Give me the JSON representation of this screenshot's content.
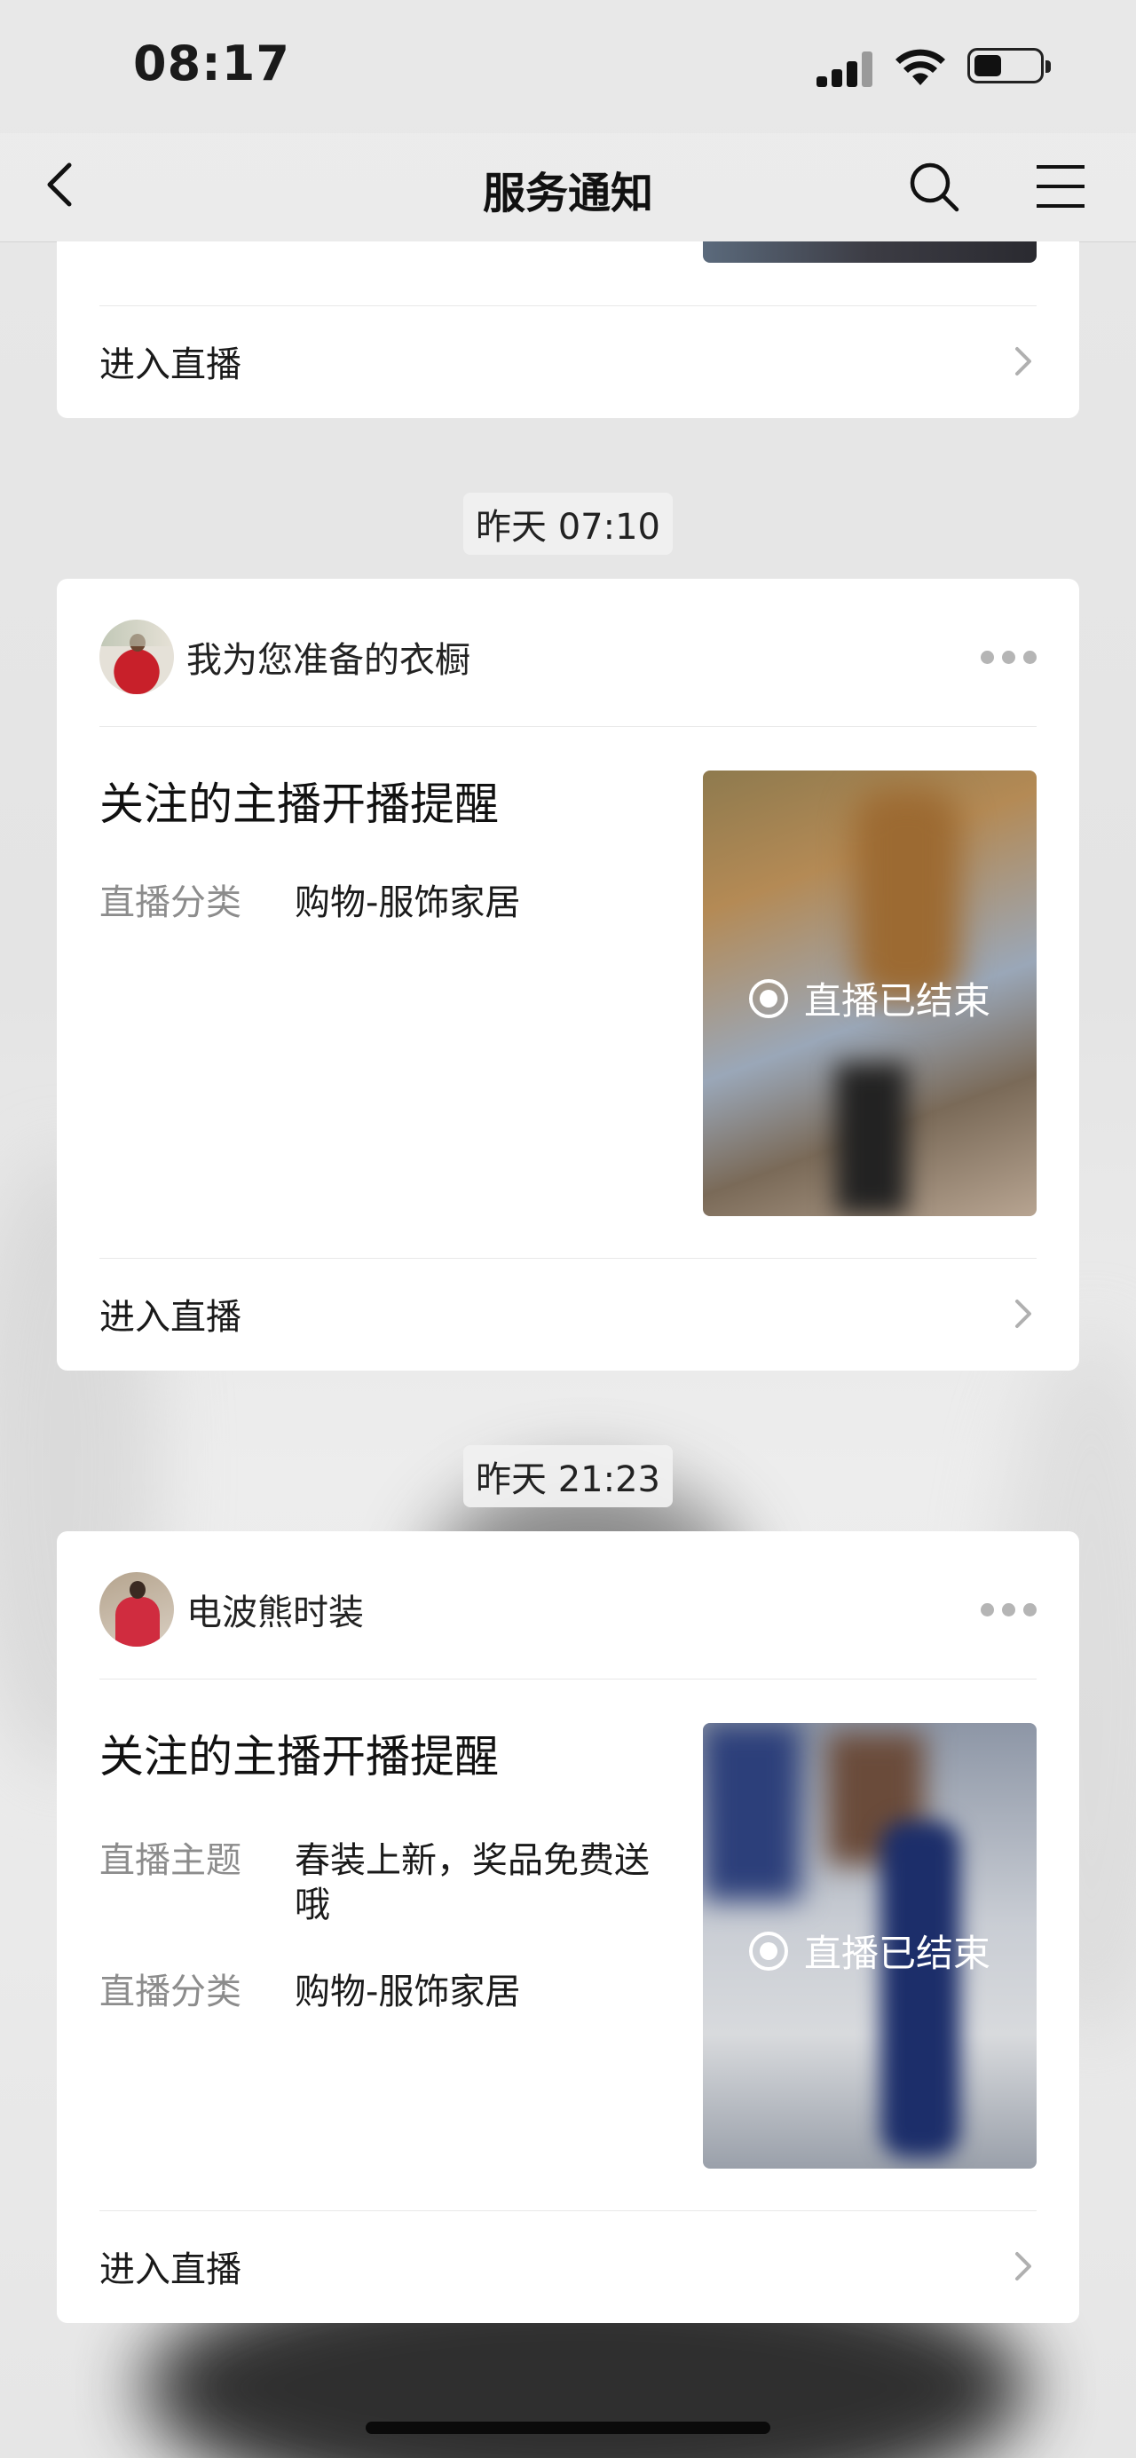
{
  "status_bar": {
    "time": "08:17"
  },
  "nav": {
    "title": "服务通知"
  },
  "top_card": {
    "enter_label": "进入直播"
  },
  "notifications": [
    {
      "timestamp": "昨天 07:10",
      "account": "我为您准备的衣橱",
      "title": "关注的主播开播提醒",
      "fields": [
        {
          "key": "直播分类",
          "value": "购物-服饰家居"
        }
      ],
      "thumb_status": "直播已结束",
      "enter_label": "进入直播"
    },
    {
      "timestamp": "昨天 21:23",
      "account": "电波熊时装",
      "title": "关注的主播开播提醒",
      "fields": [
        {
          "key": "直播主题",
          "value": "春装上新，奖品免费送哦"
        },
        {
          "key": "直播分类",
          "value": "购物-服饰家居"
        }
      ],
      "thumb_status": "直播已结束",
      "enter_label": "进入直播"
    }
  ]
}
